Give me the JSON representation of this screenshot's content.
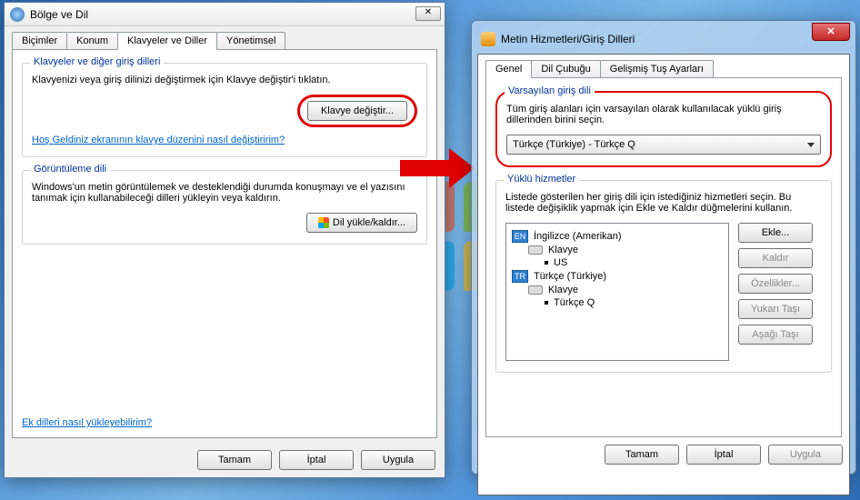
{
  "left": {
    "title": "Bölge ve Dil",
    "tabs": [
      "Biçimler",
      "Konum",
      "Klavyeler ve Diller",
      "Yönetimsel"
    ],
    "active_tab": 2,
    "group1": {
      "title": "Klavyeler ve diğer giriş dilleri",
      "text": "Klavyenizi veya giriş dilinizi değiştirmek için Klavye değiştir'i tıklatın.",
      "button": "Klavye değiştir...",
      "link": "Hoş Geldiniz ekranının klavye düzenini nasıl değiştiririm?"
    },
    "group2": {
      "title": "Görüntüleme dili",
      "text": "Windows'un metin görüntülemek ve desteklendiği durumda konuşmayı ve el yazısını tanımak için kullanabileceği dilleri yükleyin veya kaldırın.",
      "button": "Dil yükle/kaldır..."
    },
    "bottom_link": "Ek dilleri nasıl yükleyebilirim?",
    "buttons": {
      "ok": "Tamam",
      "cancel": "İptal",
      "apply": "Uygula"
    }
  },
  "right": {
    "title": "Metin Hizmetleri/Giriş Dilleri",
    "tabs": [
      "Genel",
      "Dil Çubuğu",
      "Gelişmiş Tuş Ayarları"
    ],
    "active_tab": 0,
    "default_group": {
      "title": "Varsayılan giriş dili",
      "text": "Tüm giriş alanları için varsayılan olarak kullanılacak yüklü giriş dillerinden birini seçin.",
      "selected": "Türkçe (Türkiye) - Türkçe Q"
    },
    "installed_group": {
      "title": "Yüklü hizmetler",
      "text": "Listede gösterilen her giriş dili için istediğiniz hizmetleri seçin. Bu listede değişiklik yapmak için Ekle ve Kaldır düğmelerini kullanın.",
      "tree": [
        {
          "badge": "EN",
          "label": "İngilizce (Amerikan)"
        },
        {
          "kb": true,
          "label": "Klavye",
          "indent": 1
        },
        {
          "bullet": true,
          "label": "US",
          "indent": 2
        },
        {
          "badge": "TR",
          "label": "Türkçe (Türkiye)"
        },
        {
          "kb": true,
          "label": "Klavye",
          "indent": 1
        },
        {
          "bullet": true,
          "label": "Türkçe Q",
          "indent": 2
        }
      ],
      "buttons": {
        "add": "Ekle...",
        "remove": "Kaldır",
        "props": "Özellikler...",
        "up": "Yukarı Taşı",
        "down": "Aşağı Taşı"
      }
    },
    "buttons": {
      "ok": "Tamam",
      "cancel": "İptal",
      "apply": "Uygula"
    }
  }
}
